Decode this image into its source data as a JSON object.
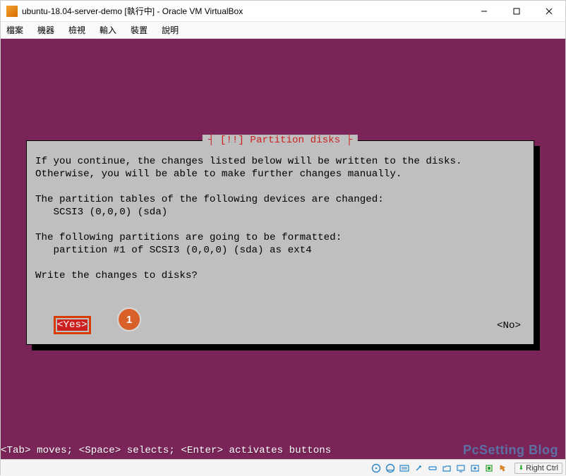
{
  "window": {
    "title": "ubuntu-18.04-server-demo [執行中] - Oracle VM VirtualBox"
  },
  "menu": {
    "items": [
      "檔案",
      "機器",
      "檢視",
      "輸入",
      "裝置",
      "說明"
    ]
  },
  "dialog": {
    "title_decorated": "┤ [!!] Partition disks ├",
    "body": "If you continue, the changes listed below will be written to the disks. Otherwise, you will be able to make further changes manually.\n\nThe partition tables of the following devices are changed:\n   SCSI3 (0,0,0) (sda)\n\nThe following partitions are going to be formatted:\n   partition #1 of SCSI3 (0,0,0) (sda) as ext4\n\nWrite the changes to disks?",
    "yes_label": "<Yes>",
    "no_label": "<No>",
    "annot_num": "1"
  },
  "vm": {
    "hint": "<Tab> moves; <Space> selects; <Enter> activates buttons",
    "watermark": "PcSetting Blog"
  },
  "status": {
    "host_key": "Right Ctrl"
  }
}
